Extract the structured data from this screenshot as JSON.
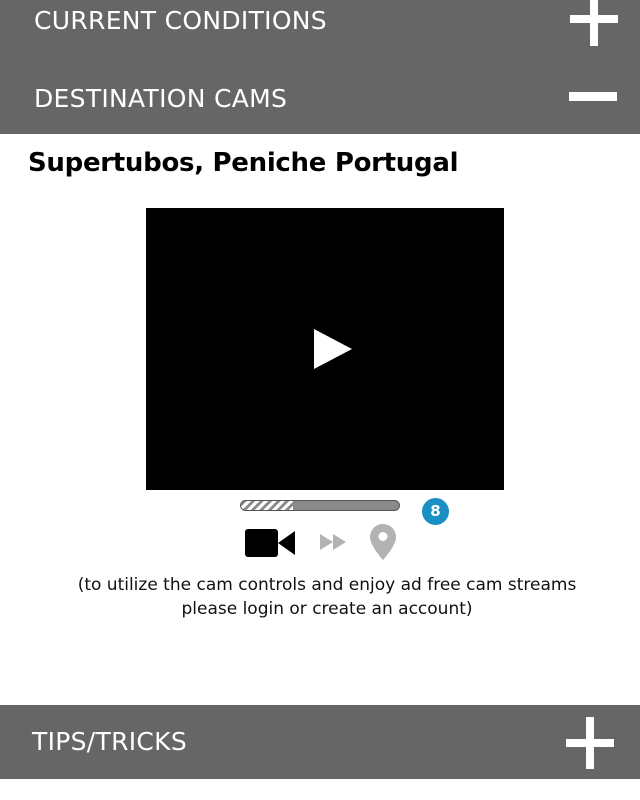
{
  "sections": {
    "current_conditions": {
      "label": "CURRENT CONDITIONS",
      "state": "collapsed",
      "toggle_icon": "plus-icon"
    },
    "destination_cams": {
      "label": "DESTINATION CAMS",
      "state": "expanded",
      "toggle_icon": "minus-icon"
    },
    "tips_tricks": {
      "label": "TIPS/TRICKS",
      "state": "collapsed",
      "toggle_icon": "plus-icon"
    }
  },
  "cam": {
    "title": "Supertubos, Peniche Portugal",
    "player": {
      "play_icon": "play-icon"
    },
    "progress_fraction": 0.33,
    "badge_count": "8",
    "controls": {
      "camera_icon": "video-camera-icon",
      "forward_icon": "fast-forward-icon",
      "location_icon": "location-pin-icon"
    },
    "login_note_line1": "(to utilize the cam controls and enjoy ad free cam streams",
    "login_note_line2": "please login or create an account)"
  },
  "colors": {
    "header_bg": "#666666",
    "header_text": "#ffffff",
    "badge_bg": "#1a8fc4",
    "active_icon": "#000000",
    "inactive_icon": "#b3b3b3"
  }
}
